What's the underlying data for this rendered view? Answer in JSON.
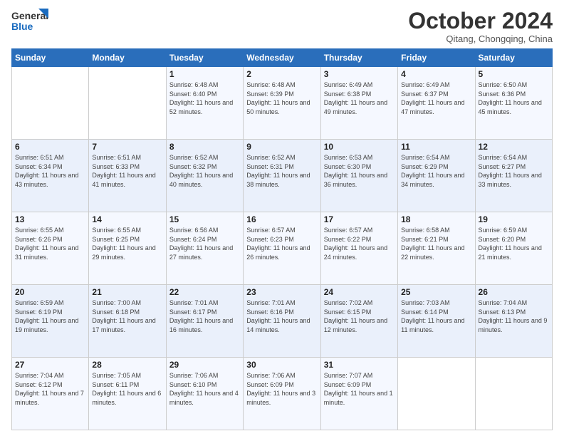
{
  "logo": {
    "line1": "General",
    "line2": "Blue"
  },
  "title": "October 2024",
  "subtitle": "Qitang, Chongqing, China",
  "weekdays": [
    "Sunday",
    "Monday",
    "Tuesday",
    "Wednesday",
    "Thursday",
    "Friday",
    "Saturday"
  ],
  "weeks": [
    [
      {
        "day": "",
        "sunrise": "",
        "sunset": "",
        "daylight": ""
      },
      {
        "day": "",
        "sunrise": "",
        "sunset": "",
        "daylight": ""
      },
      {
        "day": "1",
        "sunrise": "Sunrise: 6:48 AM",
        "sunset": "Sunset: 6:40 PM",
        "daylight": "Daylight: 11 hours and 52 minutes."
      },
      {
        "day": "2",
        "sunrise": "Sunrise: 6:48 AM",
        "sunset": "Sunset: 6:39 PM",
        "daylight": "Daylight: 11 hours and 50 minutes."
      },
      {
        "day": "3",
        "sunrise": "Sunrise: 6:49 AM",
        "sunset": "Sunset: 6:38 PM",
        "daylight": "Daylight: 11 hours and 49 minutes."
      },
      {
        "day": "4",
        "sunrise": "Sunrise: 6:49 AM",
        "sunset": "Sunset: 6:37 PM",
        "daylight": "Daylight: 11 hours and 47 minutes."
      },
      {
        "day": "5",
        "sunrise": "Sunrise: 6:50 AM",
        "sunset": "Sunset: 6:36 PM",
        "daylight": "Daylight: 11 hours and 45 minutes."
      }
    ],
    [
      {
        "day": "6",
        "sunrise": "Sunrise: 6:51 AM",
        "sunset": "Sunset: 6:34 PM",
        "daylight": "Daylight: 11 hours and 43 minutes."
      },
      {
        "day": "7",
        "sunrise": "Sunrise: 6:51 AM",
        "sunset": "Sunset: 6:33 PM",
        "daylight": "Daylight: 11 hours and 41 minutes."
      },
      {
        "day": "8",
        "sunrise": "Sunrise: 6:52 AM",
        "sunset": "Sunset: 6:32 PM",
        "daylight": "Daylight: 11 hours and 40 minutes."
      },
      {
        "day": "9",
        "sunrise": "Sunrise: 6:52 AM",
        "sunset": "Sunset: 6:31 PM",
        "daylight": "Daylight: 11 hours and 38 minutes."
      },
      {
        "day": "10",
        "sunrise": "Sunrise: 6:53 AM",
        "sunset": "Sunset: 6:30 PM",
        "daylight": "Daylight: 11 hours and 36 minutes."
      },
      {
        "day": "11",
        "sunrise": "Sunrise: 6:54 AM",
        "sunset": "Sunset: 6:29 PM",
        "daylight": "Daylight: 11 hours and 34 minutes."
      },
      {
        "day": "12",
        "sunrise": "Sunrise: 6:54 AM",
        "sunset": "Sunset: 6:27 PM",
        "daylight": "Daylight: 11 hours and 33 minutes."
      }
    ],
    [
      {
        "day": "13",
        "sunrise": "Sunrise: 6:55 AM",
        "sunset": "Sunset: 6:26 PM",
        "daylight": "Daylight: 11 hours and 31 minutes."
      },
      {
        "day": "14",
        "sunrise": "Sunrise: 6:55 AM",
        "sunset": "Sunset: 6:25 PM",
        "daylight": "Daylight: 11 hours and 29 minutes."
      },
      {
        "day": "15",
        "sunrise": "Sunrise: 6:56 AM",
        "sunset": "Sunset: 6:24 PM",
        "daylight": "Daylight: 11 hours and 27 minutes."
      },
      {
        "day": "16",
        "sunrise": "Sunrise: 6:57 AM",
        "sunset": "Sunset: 6:23 PM",
        "daylight": "Daylight: 11 hours and 26 minutes."
      },
      {
        "day": "17",
        "sunrise": "Sunrise: 6:57 AM",
        "sunset": "Sunset: 6:22 PM",
        "daylight": "Daylight: 11 hours and 24 minutes."
      },
      {
        "day": "18",
        "sunrise": "Sunrise: 6:58 AM",
        "sunset": "Sunset: 6:21 PM",
        "daylight": "Daylight: 11 hours and 22 minutes."
      },
      {
        "day": "19",
        "sunrise": "Sunrise: 6:59 AM",
        "sunset": "Sunset: 6:20 PM",
        "daylight": "Daylight: 11 hours and 21 minutes."
      }
    ],
    [
      {
        "day": "20",
        "sunrise": "Sunrise: 6:59 AM",
        "sunset": "Sunset: 6:19 PM",
        "daylight": "Daylight: 11 hours and 19 minutes."
      },
      {
        "day": "21",
        "sunrise": "Sunrise: 7:00 AM",
        "sunset": "Sunset: 6:18 PM",
        "daylight": "Daylight: 11 hours and 17 minutes."
      },
      {
        "day": "22",
        "sunrise": "Sunrise: 7:01 AM",
        "sunset": "Sunset: 6:17 PM",
        "daylight": "Daylight: 11 hours and 16 minutes."
      },
      {
        "day": "23",
        "sunrise": "Sunrise: 7:01 AM",
        "sunset": "Sunset: 6:16 PM",
        "daylight": "Daylight: 11 hours and 14 minutes."
      },
      {
        "day": "24",
        "sunrise": "Sunrise: 7:02 AM",
        "sunset": "Sunset: 6:15 PM",
        "daylight": "Daylight: 11 hours and 12 minutes."
      },
      {
        "day": "25",
        "sunrise": "Sunrise: 7:03 AM",
        "sunset": "Sunset: 6:14 PM",
        "daylight": "Daylight: 11 hours and 11 minutes."
      },
      {
        "day": "26",
        "sunrise": "Sunrise: 7:04 AM",
        "sunset": "Sunset: 6:13 PM",
        "daylight": "Daylight: 11 hours and 9 minutes."
      }
    ],
    [
      {
        "day": "27",
        "sunrise": "Sunrise: 7:04 AM",
        "sunset": "Sunset: 6:12 PM",
        "daylight": "Daylight: 11 hours and 7 minutes."
      },
      {
        "day": "28",
        "sunrise": "Sunrise: 7:05 AM",
        "sunset": "Sunset: 6:11 PM",
        "daylight": "Daylight: 11 hours and 6 minutes."
      },
      {
        "day": "29",
        "sunrise": "Sunrise: 7:06 AM",
        "sunset": "Sunset: 6:10 PM",
        "daylight": "Daylight: 11 hours and 4 minutes."
      },
      {
        "day": "30",
        "sunrise": "Sunrise: 7:06 AM",
        "sunset": "Sunset: 6:09 PM",
        "daylight": "Daylight: 11 hours and 3 minutes."
      },
      {
        "day": "31",
        "sunrise": "Sunrise: 7:07 AM",
        "sunset": "Sunset: 6:09 PM",
        "daylight": "Daylight: 11 hours and 1 minute."
      },
      {
        "day": "",
        "sunrise": "",
        "sunset": "",
        "daylight": ""
      },
      {
        "day": "",
        "sunrise": "",
        "sunset": "",
        "daylight": ""
      }
    ]
  ]
}
